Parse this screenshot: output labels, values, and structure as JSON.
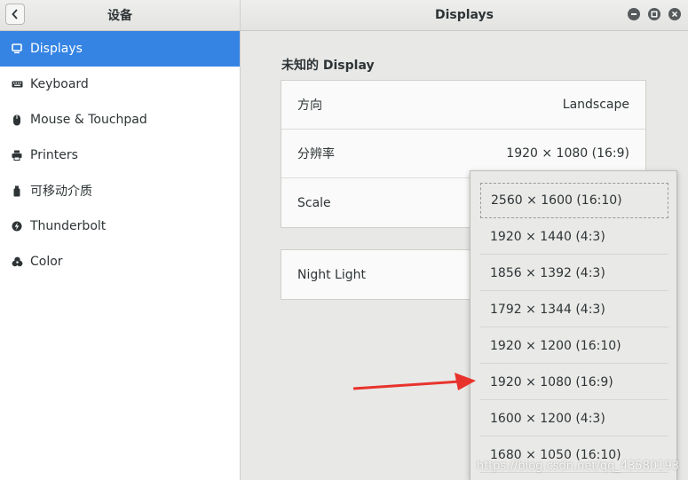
{
  "window": {
    "sidebar_title": "设备",
    "panel_title": "Displays"
  },
  "sidebar": {
    "items": [
      {
        "label": "Displays",
        "icon": "display-icon",
        "active": true
      },
      {
        "label": "Keyboard",
        "icon": "keyboard-icon",
        "active": false
      },
      {
        "label": "Mouse & Touchpad",
        "icon": "mouse-icon",
        "active": false
      },
      {
        "label": "Printers",
        "icon": "printer-icon",
        "active": false
      },
      {
        "label": "可移动介质",
        "icon": "removable-media-icon",
        "active": false
      },
      {
        "label": "Thunderbolt",
        "icon": "thunderbolt-icon",
        "active": false
      },
      {
        "label": "Color",
        "icon": "color-icon",
        "active": false
      }
    ]
  },
  "main": {
    "section_title": "未知的 Display",
    "settings": [
      {
        "label": "方向",
        "value": "Landscape"
      },
      {
        "label": "分辨率",
        "value": "1920 × 1080 (16:9)"
      },
      {
        "label": "Scale",
        "value": ""
      }
    ],
    "night_light": {
      "label": "Night Light"
    }
  },
  "resolution_popover": {
    "options": [
      "2560 × 1600 (16:10)",
      "1920 × 1440 (4:3)",
      "1856 × 1392 (4:3)",
      "1792 × 1344 (4:3)",
      "1920 × 1200 (16:10)",
      "1920 × 1080 (16:9)",
      "1600 × 1200 (4:3)",
      "1680 × 1050 (16:10)"
    ]
  },
  "watermark": "https://blog.csdn.net/qq_43580193",
  "colors": {
    "accent": "#3584e4",
    "arrow": "#e8332c"
  }
}
